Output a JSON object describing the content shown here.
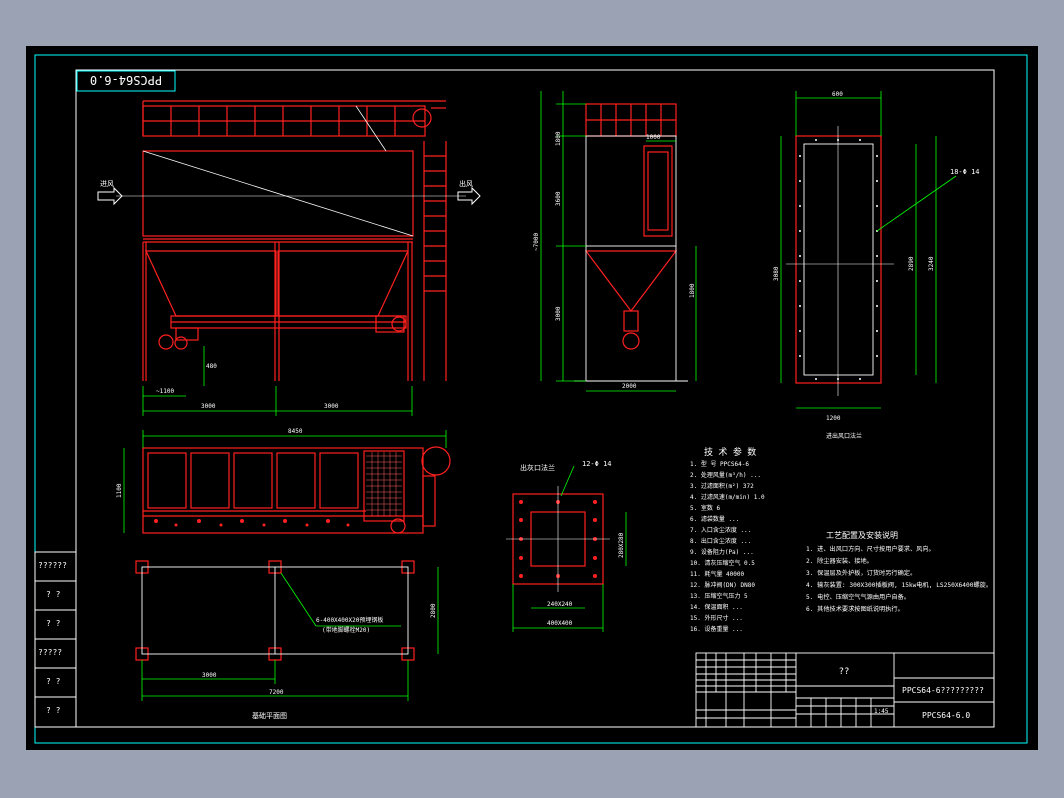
{
  "drawing": {
    "code_stamp": "PPCS64-6.0",
    "title_box": "??",
    "title_name": "PPCS64-6?????????",
    "title_code": "PPCS64-6.0",
    "title_scale": "1:45",
    "left_strip": [
      "??????",
      "? ?",
      "? ?",
      "?????",
      "? ?",
      "? ?"
    ]
  },
  "front_view": {
    "inlet_label": "进风",
    "outlet_label": "出风",
    "dim_bottom_1": "3000",
    "dim_bottom_2": "3000",
    "dim_left_bottom": "~1100",
    "dim_vertical": "480"
  },
  "side_view": {
    "dims_left": [
      "1800",
      "3600",
      "3000"
    ],
    "dim_total": "~7000",
    "dim_top_right": "1000",
    "dim_right": "1800",
    "dim_bottom": "2000"
  },
  "flange_view": {
    "dim_top": "600",
    "dim_height": "3080",
    "dim_right_1": "2890",
    "dim_right_2": "3240",
    "dim_bottom": "1200",
    "hole_label": "18-Φ 14",
    "caption": "进出风口法兰"
  },
  "plan_view": {
    "dim_top": "8450",
    "dim_left": "1100"
  },
  "foundation_view": {
    "note_line1": "6-400X400X20预埋钢板",
    "note_line2": "(带地脚螺栓M20)",
    "dim_a": "3000",
    "dim_b": "7200",
    "dim_right": "2800",
    "caption": "基础平面图"
  },
  "outlet_flange": {
    "title": "出灰口法兰",
    "hole_label": "12-Φ 14",
    "dim_inner": "240X240",
    "dim_outer": "400X400",
    "dim_side": "280X280"
  },
  "tech_params": {
    "title": "技 术 参 数",
    "rows": [
      "1. 型    号      PPCS64-6",
      "2. 处理风量(m³/h)    ...",
      "3. 过滤面积(m²)      372",
      "4. 过滤风速(m/min)   1.0",
      "5. 室数              6",
      "6. 滤袋数量          ...",
      "7. 入口含尘浓度      ...",
      "8. 出口含尘浓度      ...",
      "9. 设备阻力(Pa)    ...",
      "10. 清灰压缩空气   0.5",
      "11. 耗气量         40000",
      "12. 脉冲阀(DN)     DN80",
      "13. 压缩空气压力   5",
      "14. 保温面积       ...",
      "15. 外形尺寸       ...",
      "16. 设备重量       ..."
    ]
  },
  "process_notes": {
    "title": "工艺配置及安装说明",
    "rows": [
      "1. 进、出风口方向、尺寸按用户要求、风向。",
      "2. 除尘器安装、接地。",
      "3. 保温层及外护板，订货时另行确定。",
      "4. 输灰装置: 300X300插板阀, 15kw电机, LS250X6400螺旋。",
      "5. 电控、压缩空气气源由用户自备。",
      "6. 其他技术要求按图纸说明执行。"
    ]
  }
}
